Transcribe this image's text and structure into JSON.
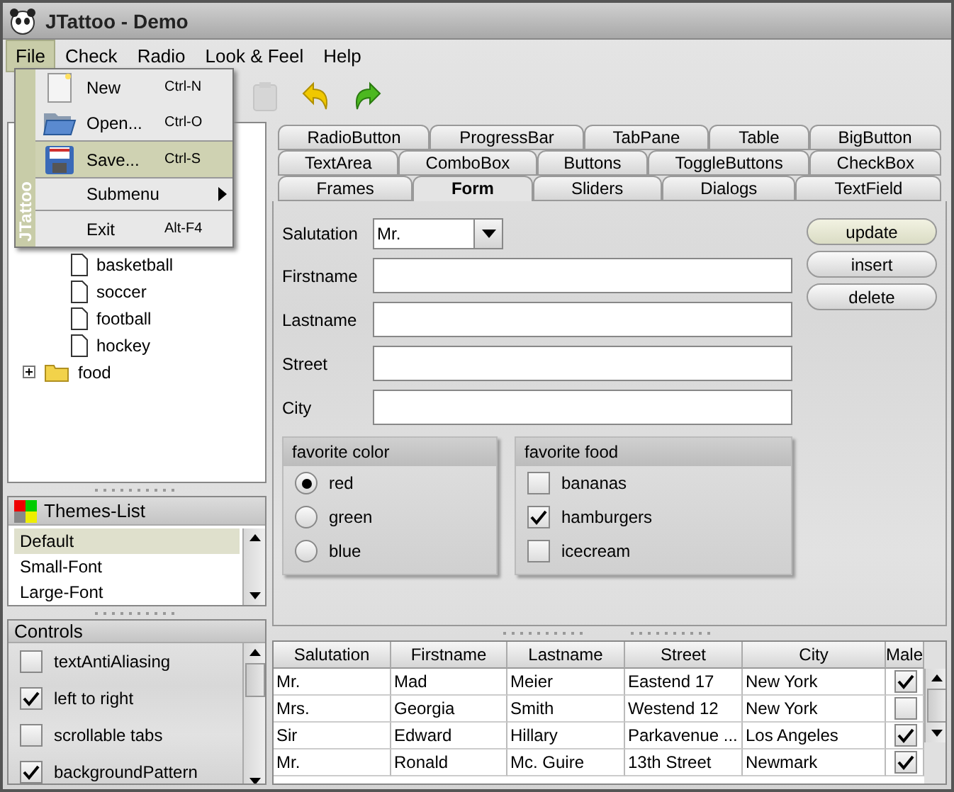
{
  "window": {
    "title": "JTattoo - Demo"
  },
  "menu_bar": [
    {
      "label": "File",
      "selected": true
    },
    {
      "label": "Check",
      "selected": false
    },
    {
      "label": "Radio",
      "selected": false
    },
    {
      "label": "Look & Feel",
      "selected": false
    },
    {
      "label": "Help",
      "selected": false
    }
  ],
  "file_menu": {
    "brand": "JTattoo",
    "items": [
      {
        "kind": "new",
        "label": "New",
        "shortcut": "Ctrl-N",
        "selected": false
      },
      {
        "kind": "open",
        "label": "Open...",
        "shortcut": "Ctrl-O",
        "selected": false
      },
      {
        "kind": "separator"
      },
      {
        "kind": "save",
        "label": "Save...",
        "shortcut": "Ctrl-S",
        "selected": true
      },
      {
        "kind": "separator"
      },
      {
        "kind": "submenu",
        "label": "Submenu",
        "selected": false
      },
      {
        "kind": "separator"
      },
      {
        "kind": "exit",
        "label": "Exit",
        "shortcut": "Alt-F4",
        "selected": false
      }
    ]
  },
  "toolbar": [
    {
      "kind": "paste",
      "disabled": true
    },
    {
      "kind": "undo",
      "disabled": false
    },
    {
      "kind": "redo",
      "disabled": false
    }
  ],
  "tree": [
    {
      "children": [
        {
          "label": "basketball"
        },
        {
          "label": "soccer"
        },
        {
          "label": "football"
        },
        {
          "label": "hockey"
        }
      ]
    },
    {
      "label": "food",
      "expanded": false
    }
  ],
  "themes_list": {
    "title": "Themes-List",
    "items": [
      {
        "label": "Default",
        "selected": true
      },
      {
        "label": "Small-Font",
        "selected": false
      },
      {
        "label": "Large-Font",
        "selected": false
      }
    ]
  },
  "controls": {
    "title": "Controls",
    "items": [
      {
        "label": "textAntiAliasing",
        "checked": false
      },
      {
        "label": "left to right",
        "checked": true
      },
      {
        "label": "scrollable tabs",
        "checked": false
      },
      {
        "label": "backgroundPattern",
        "checked": true
      }
    ]
  },
  "tabs": [
    [
      {
        "label": "RadioButton",
        "selected": false
      },
      {
        "label": "ProgressBar",
        "selected": false
      },
      {
        "label": "TabPane",
        "selected": false
      },
      {
        "label": "Table",
        "selected": false
      },
      {
        "label": "BigButton",
        "selected": false
      }
    ],
    [
      {
        "label": "TextArea",
        "selected": false
      },
      {
        "label": "ComboBox",
        "selected": false
      },
      {
        "label": "Buttons",
        "selected": false
      },
      {
        "label": "ToggleButtons",
        "selected": false
      },
      {
        "label": "CheckBox",
        "selected": false
      }
    ],
    [
      {
        "label": "Frames",
        "selected": false
      },
      {
        "label": "Form",
        "selected": true
      },
      {
        "label": "Sliders",
        "selected": false
      },
      {
        "label": "Dialogs",
        "selected": false
      },
      {
        "label": "TextField",
        "selected": false
      }
    ]
  ],
  "form": {
    "fields": [
      {
        "label": "Salutation",
        "kind": "combo",
        "value": "Mr."
      },
      {
        "label": "Firstname",
        "kind": "text"
      },
      {
        "label": "Lastname",
        "kind": "text"
      },
      {
        "label": "Street",
        "kind": "text"
      },
      {
        "label": "City",
        "kind": "text"
      }
    ],
    "buttons": [
      {
        "label": "update",
        "selected": true
      },
      {
        "label": "insert",
        "selected": false
      },
      {
        "label": "delete",
        "selected": false
      }
    ],
    "favorite_color": {
      "title": "favorite color",
      "options": [
        {
          "label": "red",
          "selected": true
        },
        {
          "label": "green",
          "selected": false
        },
        {
          "label": "blue",
          "selected": false
        }
      ]
    },
    "favorite_food": {
      "title": "favorite food",
      "options": [
        {
          "label": "bananas",
          "checked": false
        },
        {
          "label": "hamburgers",
          "checked": true
        },
        {
          "label": "icecream",
          "checked": false
        }
      ]
    }
  },
  "table": {
    "columns": [
      "Salutation",
      "Firstname",
      "Lastname",
      "Street",
      "City",
      "Male"
    ],
    "rows": [
      {
        "cells": [
          "Mr.",
          "Mad",
          "Meier",
          "Eastend 17",
          "New York"
        ],
        "male": true
      },
      {
        "cells": [
          "Mrs.",
          "Georgia",
          "Smith",
          "Westend 12",
          "New York"
        ],
        "male": false
      },
      {
        "cells": [
          "Sir",
          "Edward",
          "Hillary",
          "Parkavenue ...",
          "Los Angeles"
        ],
        "male": true
      },
      {
        "cells": [
          "Mr.",
          "Ronald",
          "Mc. Guire",
          "13th Street",
          "Newmark"
        ],
        "male": true
      }
    ]
  }
}
